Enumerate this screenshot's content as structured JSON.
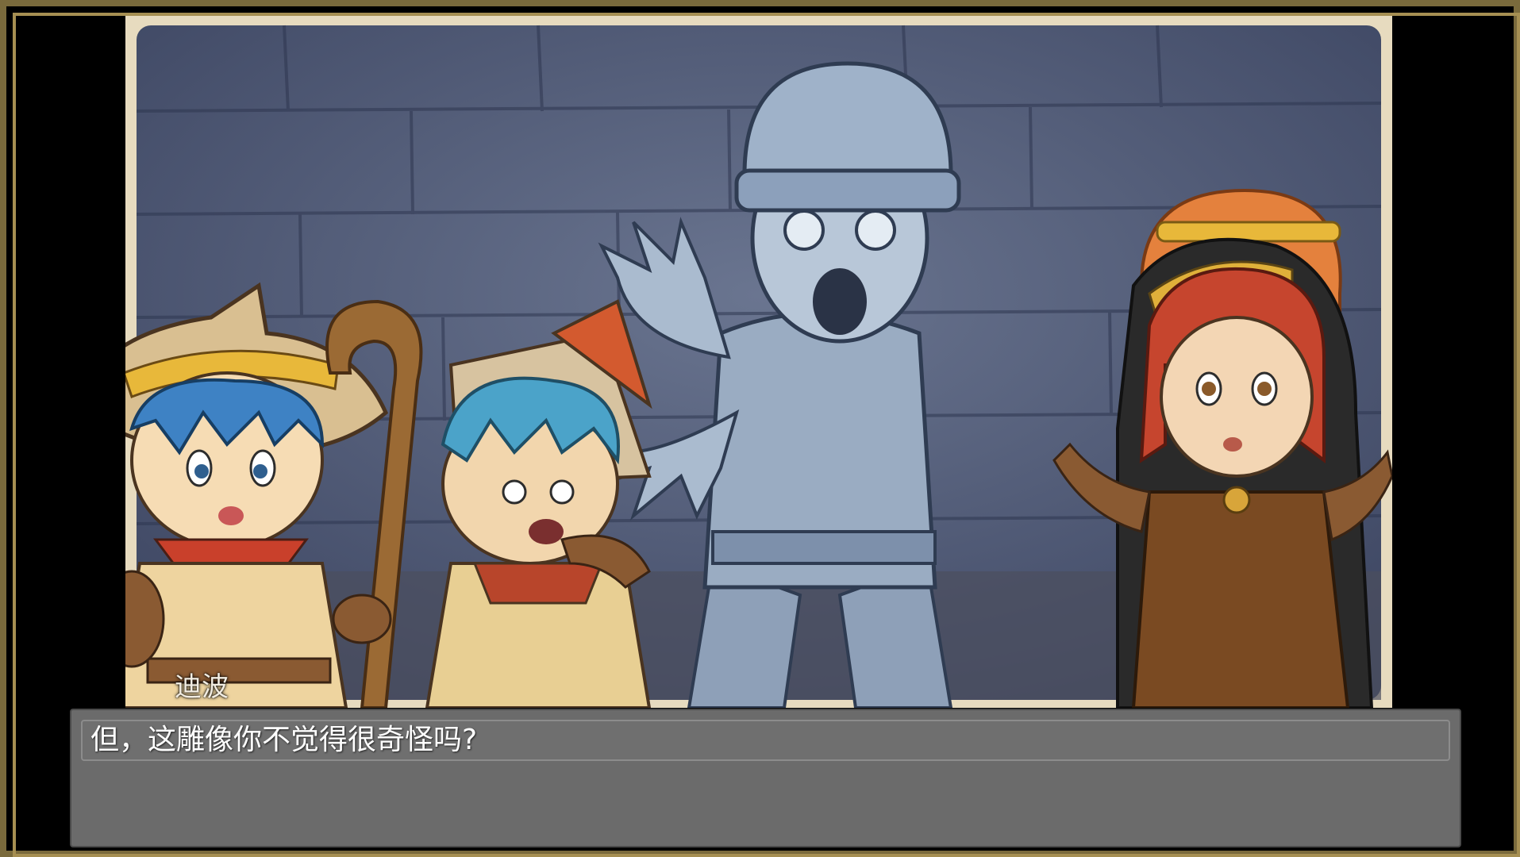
{
  "dialog": {
    "speaker": "迪波",
    "text": "但，这雕像你不觉得很奇怪吗?"
  },
  "colors": {
    "frame": "#7a6a3c",
    "dialog_bg": "#6b6b6b",
    "scene_wall": "#4a5670"
  },
  "scene": {
    "characters": [
      "wizard-boy",
      "companion-boy",
      "knight-statue",
      "orange-hair-girl",
      "hooded-girl"
    ]
  }
}
